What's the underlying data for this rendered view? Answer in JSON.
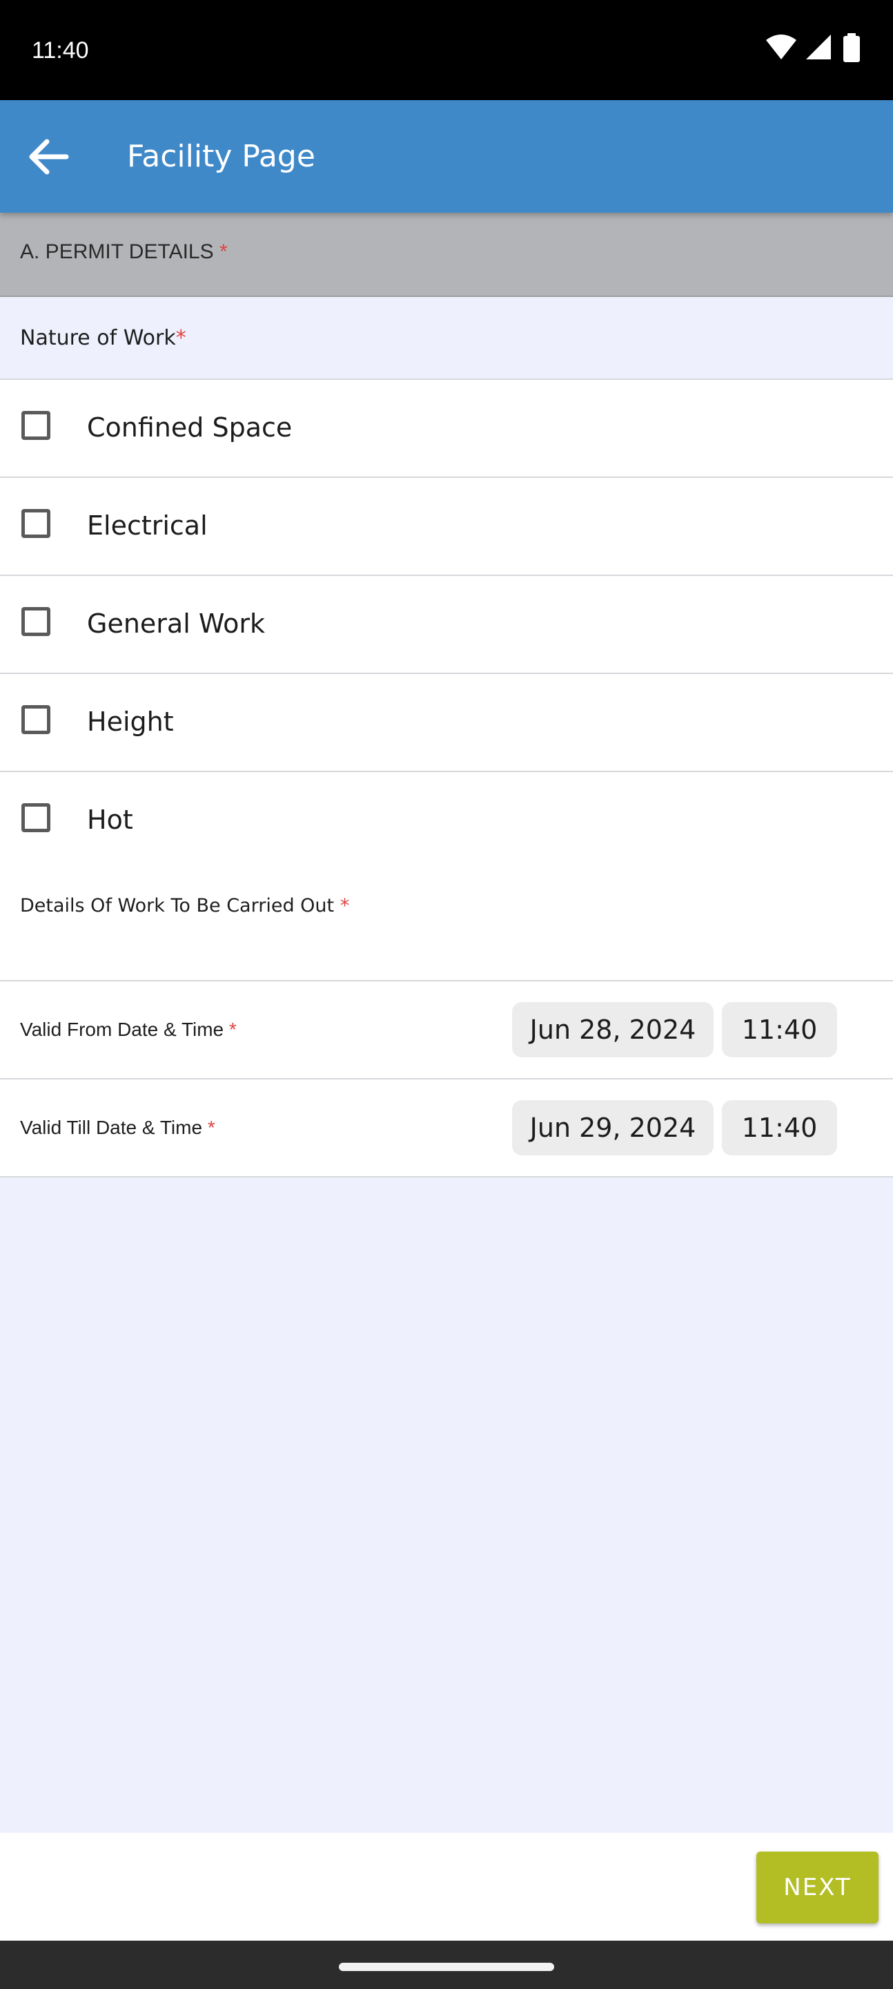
{
  "status_bar": {
    "time": "11:40",
    "icons": [
      "wifi-icon",
      "signal-icon",
      "battery-icon"
    ]
  },
  "app_bar": {
    "back_icon": "arrow-left-icon",
    "title": "Facility Page"
  },
  "section": {
    "title": "A. PERMIT DETAILS",
    "required_mark": "*"
  },
  "nature_of_work": {
    "label": "Nature of Work",
    "required_mark": "*",
    "options": [
      {
        "label": "Confined Space",
        "checked": false
      },
      {
        "label": "Electrical",
        "checked": false
      },
      {
        "label": "General Work",
        "checked": false
      },
      {
        "label": "Height",
        "checked": false
      },
      {
        "label": "Hot",
        "checked": false
      }
    ]
  },
  "details": {
    "label": "Details Of Work To Be Carried Out",
    "required_mark": "*",
    "value": ""
  },
  "valid_from": {
    "label": "Valid From Date & Time",
    "required_mark": "*",
    "date": "Jun 28, 2024",
    "time": "11:40"
  },
  "valid_till": {
    "label": "Valid Till Date & Time",
    "required_mark": "*",
    "date": "Jun 29, 2024",
    "time": "11:40"
  },
  "footer": {
    "next_label": "NEXT"
  },
  "colors": {
    "app_bar": "#3f89c9",
    "next_button": "#b3bd24",
    "required": "#e04343",
    "background": "#eef1fd"
  }
}
